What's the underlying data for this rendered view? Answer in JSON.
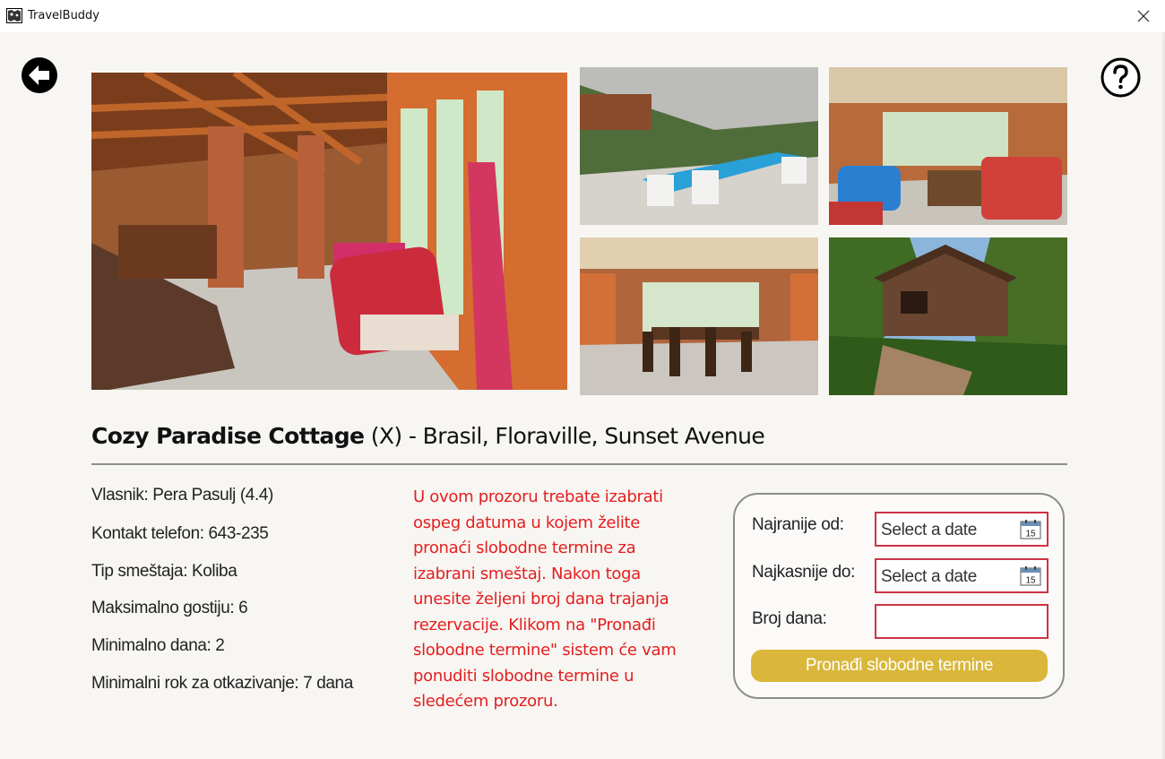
{
  "window": {
    "title": "TravelBuddy"
  },
  "heading": {
    "name": "Cozy Paradise Cottage",
    "id_text": " (X)",
    "location": " - Brasil, Floraville, Sunset Avenue"
  },
  "details": [
    "Vlasnik: Pera Pasulj (4.4)",
    "Kontakt telefon: 643-235",
    "Tip smeštaja: Koliba",
    "Maksimalno gostiju: 6",
    "Minimalno dana: 2",
    "Minimalni rok za otkazivanje: 7 dana"
  ],
  "instructions": [
    "U ovom prozoru trebate izabrati",
    "ospeg datuma u kojem želite",
    "pronaći slobodne termine za",
    "izabrani smeštaj. Nakon toga",
    "unesite željeni broj dana trajanja",
    "rezervacije. Klikom na \"Pronađi",
    "slobodne termine\" sistem će vam",
    "ponuditi slobodne termine u",
    "sledećem prozoru."
  ],
  "form": {
    "earliest_label": "Najranije od:",
    "latest_label": "Najkasnije do:",
    "days_label": "Broj dana:",
    "date_placeholder": "Select a date",
    "calendar_day": "15",
    "days_value": "",
    "submit_label": "Pronađi slobodne termine"
  },
  "icons": {
    "back": "back-arrow-icon",
    "help": "question-mark-icon",
    "close": "close-icon",
    "calendar": "calendar-icon"
  },
  "colors": {
    "background": "#f8f6f3",
    "instruction_text": "#e41e1e",
    "input_border": "#cc3344",
    "button": "#dab73a"
  }
}
